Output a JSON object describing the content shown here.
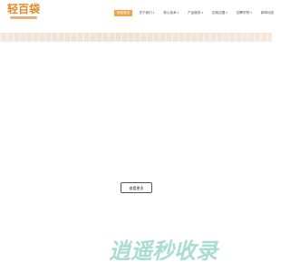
{
  "header": {
    "logo_text": "轻百袋",
    "nav": [
      {
        "label": "网站首页",
        "active": true,
        "caret": false
      },
      {
        "label": "关于我们",
        "active": false,
        "caret": true
      },
      {
        "label": "核心技术",
        "active": false,
        "caret": true
      },
      {
        "label": "产品服务",
        "active": false,
        "caret": true
      },
      {
        "label": "招商加盟",
        "active": false,
        "caret": true
      },
      {
        "label": "招聘学院",
        "active": false,
        "caret": true
      },
      {
        "label": "新闻动态",
        "active": false,
        "caret": false
      }
    ],
    "caret_glyph": "▾"
  },
  "main": {
    "more_button_label": "查看更多"
  },
  "watermark": {
    "text": "逍遥秒收录"
  },
  "colors": {
    "accent": "#f0a34a",
    "logo": "#e08a2c",
    "watermark": "#a8ddd0"
  }
}
